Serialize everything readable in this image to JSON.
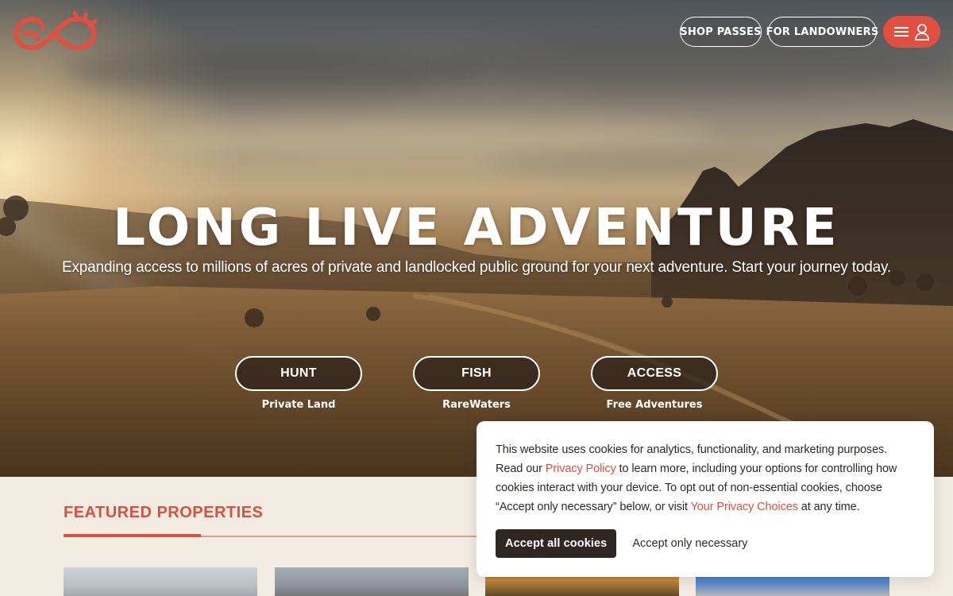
{
  "header": {
    "logo_icon": "antler-infinity-logo",
    "nav": {
      "shop_passes": "SHOP PASSES",
      "for_landowners": "FOR LANDOWNERS"
    },
    "menu_icon": "hamburger-icon",
    "account_icon": "user-icon",
    "accent_color": "#e04f3f"
  },
  "hero": {
    "title": "LONG LIVE ADVENTURE",
    "subtitle": "Expanding access to millions of acres of private and landlocked public ground for your next adventure. Start your journey today.",
    "ctas": [
      {
        "label": "HUNT",
        "sub": "Private Land"
      },
      {
        "label": "FISH",
        "sub": "RareWaters"
      },
      {
        "label": "ACCESS",
        "sub": "Free Adventures"
      }
    ]
  },
  "featured": {
    "title": "FEATURED PROPERTIES"
  },
  "cookie_banner": {
    "text_1": "This website uses cookies for analytics, functionality, and marketing purposes. Read our ",
    "privacy_policy_link": "Privacy Policy",
    "text_2": " to learn more, including your options for controlling how cookies interact with your device. To opt out of non-essential cookies, choose “Accept only necessary” below, or visit ",
    "privacy_choices_link": "Your Privacy Choices",
    "text_3": " at any time.",
    "accept_all": "Accept all cookies",
    "accept_necessary": "Accept only necessary"
  }
}
